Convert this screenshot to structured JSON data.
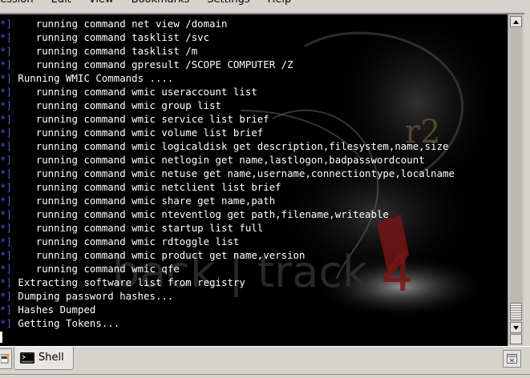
{
  "menu": {
    "items": [
      "Session",
      "Edit",
      "View",
      "Bookmarks",
      "Settings",
      "Help"
    ]
  },
  "terminal": {
    "lines": [
      {
        "prefix": "*]",
        "text": "    running command net view /domain"
      },
      {
        "prefix": "*]",
        "text": "    running command tasklist /svc"
      },
      {
        "prefix": "*]",
        "text": "    running command tasklist /m"
      },
      {
        "prefix": "*]",
        "text": "    running command gpresult /SCOPE COMPUTER /Z"
      },
      {
        "prefix": "*]",
        "text": " Running WMIC Commands ...."
      },
      {
        "prefix": "*]",
        "text": "    running command wmic useraccount list"
      },
      {
        "prefix": "*]",
        "text": "    running command wmic group list"
      },
      {
        "prefix": "*]",
        "text": "    running command wmic service list brief"
      },
      {
        "prefix": "*]",
        "text": "    running command wmic volume list brief"
      },
      {
        "prefix": "*]",
        "text": "    running command wmic logicaldisk get description,filesystem,name,size"
      },
      {
        "prefix": "*]",
        "text": "    running command wmic netlogin get name,lastlogon,badpasswordcount"
      },
      {
        "prefix": "*]",
        "text": "    running command wmic netuse get name,username,connectiontype,localname"
      },
      {
        "prefix": "*]",
        "text": "    running command wmic netclient list brief"
      },
      {
        "prefix": "*]",
        "text": "    running command wmic share get name,path"
      },
      {
        "prefix": "*]",
        "text": "    running command wmic nteventlog get path,filename,writeable"
      },
      {
        "prefix": "*]",
        "text": "    running command wmic startup list full"
      },
      {
        "prefix": "*]",
        "text": "    running command wmic rdtoggle list"
      },
      {
        "prefix": "*]",
        "text": "    running command wmic product get name,version"
      },
      {
        "prefix": "*]",
        "text": "    running command wmic qfe"
      },
      {
        "prefix": "*]",
        "text": " Extracting software list from registry"
      },
      {
        "prefix": "*]",
        "text": " Dumping password hashes..."
      },
      {
        "prefix": "*]",
        "text": " Hashes Dumped"
      },
      {
        "prefix": "*]",
        "text": " Getting Tokens..."
      }
    ],
    "wallpaper_text": "back | track",
    "wallpaper_version": "4",
    "wallpaper_badge": "r2"
  },
  "tabs": [
    {
      "label": "Shell",
      "icon": "terminal-icon",
      "active": true
    }
  ],
  "colors": {
    "prefix": "#3a5ed8",
    "text": "#ffffff",
    "background": "#000000",
    "wallpaper_accent": "#7a1414"
  },
  "icons": {
    "new_tab": "new-tab-icon",
    "close_tab": "close-tab-icon",
    "scroll_up": "arrow-up-icon",
    "scroll_down": "arrow-down-icon"
  }
}
